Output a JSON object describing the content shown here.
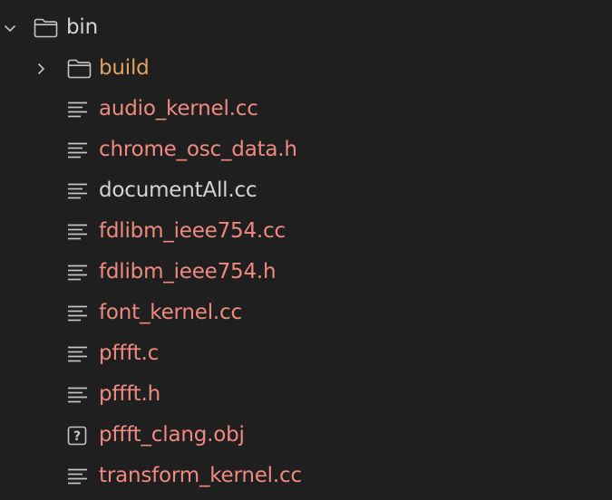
{
  "explorer": {
    "root": {
      "label": "bin",
      "expanded": true,
      "icon": "folder-icon",
      "color": "#d4d4d4"
    },
    "items": [
      {
        "label": "build",
        "type": "folder",
        "icon": "folder-icon",
        "color": "#e2a062"
      },
      {
        "label": "audio_kernel.cc",
        "type": "file",
        "icon": "lines-file-icon",
        "color": "#ef8a80"
      },
      {
        "label": "chrome_osc_data.h",
        "type": "file",
        "icon": "lines-file-icon",
        "color": "#ef8a80"
      },
      {
        "label": "documentAll.cc",
        "type": "file",
        "icon": "lines-file-icon",
        "color": "#d4d4d4"
      },
      {
        "label": "fdlibm_ieee754.cc",
        "type": "file",
        "icon": "lines-file-icon",
        "color": "#ef8a80"
      },
      {
        "label": "fdlibm_ieee754.h",
        "type": "file",
        "icon": "lines-file-icon",
        "color": "#ef8a80"
      },
      {
        "label": "font_kernel.cc",
        "type": "file",
        "icon": "lines-file-icon",
        "color": "#ef8a80"
      },
      {
        "label": "pffft.c",
        "type": "file",
        "icon": "lines-file-icon",
        "color": "#ef8a80"
      },
      {
        "label": "pffft.h",
        "type": "file",
        "icon": "lines-file-icon",
        "color": "#ef8a80"
      },
      {
        "label": "pffft_clang.obj",
        "type": "file",
        "icon": "unknown-file-icon",
        "color": "#ef8a80"
      },
      {
        "label": "transform_kernel.cc",
        "type": "file",
        "icon": "lines-file-icon",
        "color": "#ef8a80"
      }
    ]
  }
}
